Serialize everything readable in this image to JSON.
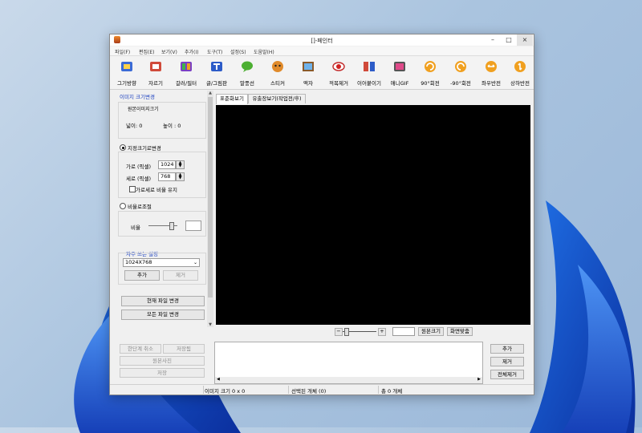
{
  "window": {
    "title": "[]-페인터",
    "minimize": "–",
    "maximize": "□",
    "close": "×"
  },
  "menu": [
    "파일(F)",
    "편집(E)",
    "보기(V)",
    "추가(I)",
    "도구(T)",
    "설정(S)",
    "도움말(H)"
  ],
  "toolbar": [
    {
      "label": "그기방향",
      "icon": "image-size-icon"
    },
    {
      "label": "자르기",
      "icon": "crop-icon"
    },
    {
      "label": "갈러/필터",
      "icon": "color-filter-icon"
    },
    {
      "label": "글/그림판",
      "icon": "text-draw-icon"
    },
    {
      "label": "말풍선",
      "icon": "speech-bubble-icon"
    },
    {
      "label": "스티커",
      "icon": "sticker-icon"
    },
    {
      "label": "액자",
      "icon": "frame-icon"
    },
    {
      "label": "적목제거",
      "icon": "red-eye-icon"
    },
    {
      "label": "이어붙이기",
      "icon": "merge-icon"
    },
    {
      "label": "애니GIF",
      "icon": "gif-icon"
    },
    {
      "label": "90°회전",
      "icon": "rotate-right-icon"
    },
    {
      "label": "-90°회전",
      "icon": "rotate-left-icon"
    },
    {
      "label": "좌우반전",
      "icon": "flip-horizontal-icon"
    },
    {
      "label": "상하반전",
      "icon": "flip-vertical-icon"
    }
  ],
  "left_panel": {
    "section_title": "이미지 크기변경",
    "original_group": "원본이미지크기",
    "width_label": "넓이: 0",
    "height_label": "높이 : 0",
    "fixed_size_label": "지정크기로변경",
    "width_field_label": "가로 (픽셀)",
    "width_value": "1024",
    "height_field_label": "세로 (픽셀)",
    "height_value": "768",
    "keep_ratio_label": "가로세로 비율 유지",
    "ratio_label": "비율로조절",
    "ratio_field_label": "비율",
    "frequent_title": "자주 쓰는 설정",
    "preset_value": "1024X768",
    "add_label": "추가",
    "remove_label": "제거",
    "current_file_btn": "현재 파일 변경",
    "all_files_btn": "모든 파일 변경",
    "undo_btn": "한단계 취소",
    "save_settings_btn": "저장됨",
    "preview_btn": "원본사진",
    "save_btn": "저장"
  },
  "tabs": [
    "표준화보기",
    "유출장보기(작업전/후)"
  ],
  "zoom": {
    "minus": "−",
    "plus": "+",
    "original_btn": "원본크기",
    "fit_btn": "화면맞춤"
  },
  "file_buttons": {
    "add": "추가",
    "remove": "제거",
    "remove_all": "전체제거"
  },
  "status": {
    "size": "이미지 크기 0 x 0",
    "selected": "선택된 개체 (0)",
    "total": "총 0 개체"
  }
}
